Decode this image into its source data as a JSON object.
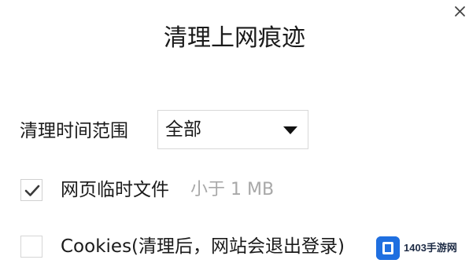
{
  "dialog": {
    "title": "清理上网痕迹",
    "close_icon": "close-icon"
  },
  "range": {
    "label": "清理时间范围",
    "selected": "全部",
    "arrow_icon": "caret-down-icon"
  },
  "options": [
    {
      "label": "网页临时文件",
      "note": "小于 1 MB",
      "checked": true
    },
    {
      "label": "Cookies(清理后，网站会退出登录)",
      "note": "",
      "checked": false
    }
  ],
  "watermark": {
    "text": "1403手游网",
    "logo_icon": "watermark-logo-icon",
    "brand_color": "#1f6fe0"
  },
  "colors": {
    "text": "#1a1a1a",
    "muted": "#a8a8a8",
    "border": "#d8d8d8"
  }
}
